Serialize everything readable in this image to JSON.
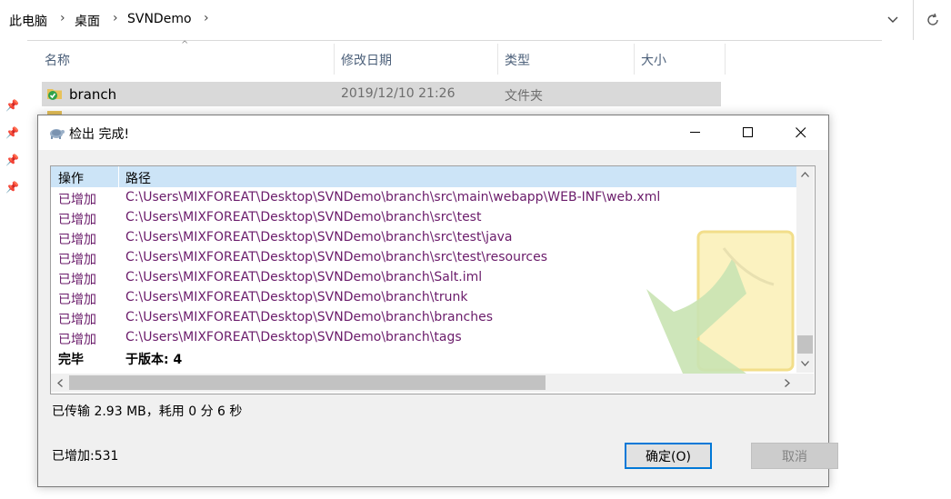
{
  "explorer": {
    "breadcrumb": [
      "此电脑",
      "桌面",
      "SVNDemo"
    ],
    "columns": {
      "name": "名称",
      "date": "修改日期",
      "type": "类型",
      "size": "大小"
    },
    "file": {
      "name": "branch",
      "date": "2019/12/10 21:26",
      "type": "文件夹"
    }
  },
  "dialog": {
    "title": "检出 完成!",
    "header": {
      "action": "操作",
      "path": "路径"
    },
    "rows": [
      {
        "action": "已增加",
        "path": "C:\\Users\\MIXFOREAT\\Desktop\\SVNDemo\\branch\\src\\main\\webapp\\WEB-INF\\web.xml"
      },
      {
        "action": "已增加",
        "path": "C:\\Users\\MIXFOREAT\\Desktop\\SVNDemo\\branch\\src\\test"
      },
      {
        "action": "已增加",
        "path": "C:\\Users\\MIXFOREAT\\Desktop\\SVNDemo\\branch\\src\\test\\java"
      },
      {
        "action": "已增加",
        "path": "C:\\Users\\MIXFOREAT\\Desktop\\SVNDemo\\branch\\src\\test\\resources"
      },
      {
        "action": "已增加",
        "path": "C:\\Users\\MIXFOREAT\\Desktop\\SVNDemo\\branch\\Salt.iml"
      },
      {
        "action": "已增加",
        "path": "C:\\Users\\MIXFOREAT\\Desktop\\SVNDemo\\branch\\trunk"
      },
      {
        "action": "已增加",
        "path": "C:\\Users\\MIXFOREAT\\Desktop\\SVNDemo\\branch\\branches"
      },
      {
        "action": "已增加",
        "path": "C:\\Users\\MIXFOREAT\\Desktop\\SVNDemo\\branch\\tags"
      },
      {
        "action": "完毕",
        "path": "于版本: 4"
      }
    ],
    "transfer_text": "已传输 2.93 MB，耗用 0 分 6 秒",
    "added_text": "已增加:531",
    "ok_label": "确定(O)",
    "cancel_label": "取消"
  },
  "colors": {
    "action_text": "#6a1b6a",
    "header_bg": "#cce4f7",
    "ok_border": "#0078d7"
  }
}
